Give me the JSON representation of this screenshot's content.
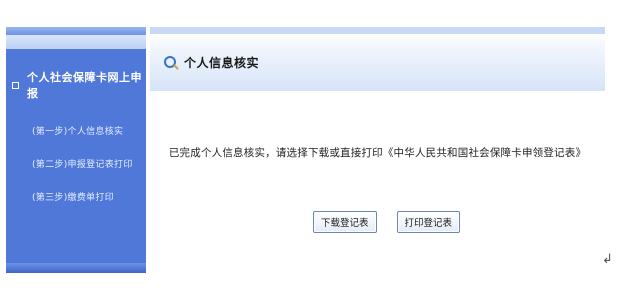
{
  "sidebar": {
    "section_title": "个人社会保障卡网上申报",
    "items": [
      {
        "label": "(第一步)个人信息核实"
      },
      {
        "label": "(第二步)申报登记表打印"
      },
      {
        "label": "(第三步)缴费单打印"
      }
    ]
  },
  "panel": {
    "title": "个人信息核实",
    "message": "已完成个人信息核实，请选择下载或直接打印《中华人民共和国社会保障卡申领登记表》",
    "buttons": {
      "download_label": "下载登记表",
      "print_label": "打印登记表"
    }
  },
  "return_mark": "↲",
  "colors": {
    "sidebar_bg": "#4f78d9",
    "header_gradient_end": "#d6e4f8",
    "button_border": "#6c86b8"
  }
}
